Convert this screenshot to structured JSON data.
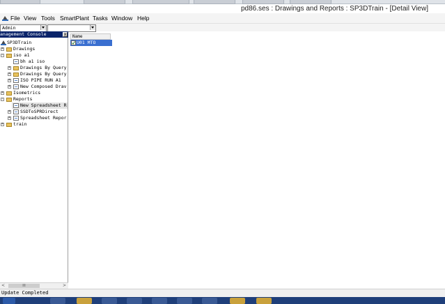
{
  "window": {
    "title": "pd86.ses : Drawings and Reports : SP3DTrain - [Detail View]"
  },
  "menubar": {
    "items": [
      "File",
      "View",
      "Tools",
      "SmartPlant",
      "Tasks",
      "Window",
      "Help"
    ]
  },
  "toolbar": {
    "role_value": "Admin",
    "filter_value": ""
  },
  "console": {
    "title": "anagement Console",
    "close_label": "x",
    "tree": [
      {
        "label": "SP3DTrain",
        "expander": ""
      },
      {
        "label": "Drawings",
        "expander": "+"
      },
      {
        "label": "iso a1",
        "expander": "-"
      },
      {
        "label": "bh a1 iso",
        "expander": ""
      },
      {
        "label": "Drawings By Query",
        "expander": "+"
      },
      {
        "label": "Drawings By Query",
        "expander": "+"
      },
      {
        "label": "ISO PIPE RUN A1",
        "expander": "+"
      },
      {
        "label": "New Composed Drav",
        "expander": "+"
      },
      {
        "label": "Isometrics",
        "expander": "+"
      },
      {
        "label": "Reports",
        "expander": "-"
      },
      {
        "label": "New Spreadsheet R",
        "expander": ""
      },
      {
        "label": "SSDToSPRDirect",
        "expander": "+"
      },
      {
        "label": "Spreadsheet Repor",
        "expander": "+"
      },
      {
        "label": "train",
        "expander": "+"
      }
    ],
    "hscroll": {
      "left_arrow": "<",
      "right_arrow": ">",
      "thumb_grip": "III"
    }
  },
  "detail": {
    "column_header": "Name",
    "rows": [
      {
        "name": "U01 MTO",
        "selected": true
      }
    ]
  },
  "status": {
    "text": "Update Completed"
  },
  "icons": {
    "app": "app-logo-icon",
    "folder": "folder-icon",
    "document": "report-document-icon",
    "close": "close-icon"
  },
  "colors": {
    "console_header": "#0a246a",
    "selection": "#3a6fd0",
    "taskbar": "#1f3f7a"
  }
}
